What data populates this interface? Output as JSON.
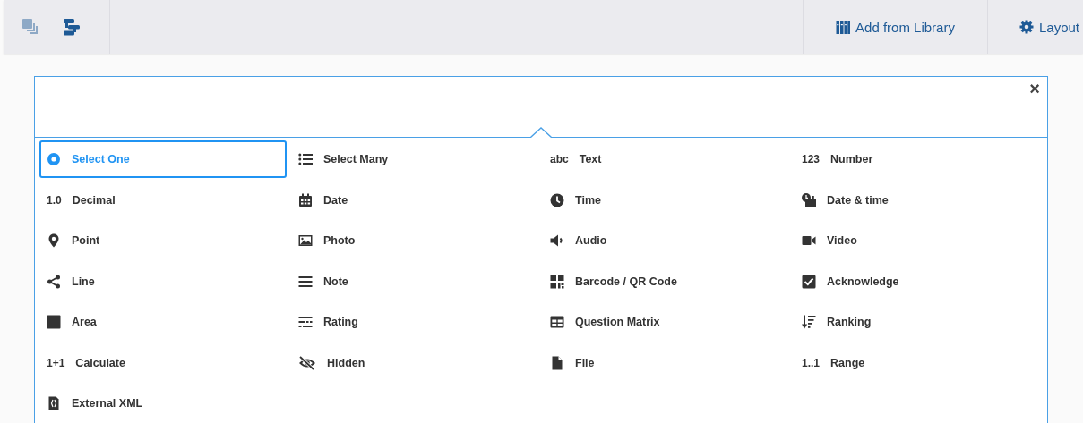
{
  "toolbar": {
    "left_icons": [
      {
        "kind": "layers",
        "disabled": true
      },
      {
        "kind": "groups",
        "disabled": false
      }
    ],
    "buttons": [
      {
        "kind": "library",
        "label": "Add from Library"
      },
      {
        "kind": "gear",
        "label": "Layout"
      }
    ]
  },
  "picker": {
    "close": "×",
    "items": [
      {
        "kind": "radio",
        "label": "Select One",
        "selected": true
      },
      {
        "kind": "list",
        "label": "Select Many",
        "selected": false
      },
      {
        "kind": "glyph",
        "glyph": "abc",
        "label": "Text",
        "selected": false
      },
      {
        "kind": "glyph",
        "glyph": "123",
        "label": "Number",
        "selected": false
      },
      {
        "kind": "glyph",
        "glyph": "1.0",
        "label": "Decimal",
        "selected": false
      },
      {
        "kind": "calendar",
        "label": "Date",
        "selected": false
      },
      {
        "kind": "clock",
        "label": "Time",
        "selected": false
      },
      {
        "kind": "datetime",
        "label": "Date & time",
        "selected": false
      },
      {
        "kind": "pin",
        "label": "Point",
        "selected": false
      },
      {
        "kind": "image",
        "label": "Photo",
        "selected": false
      },
      {
        "kind": "speaker",
        "label": "Audio",
        "selected": false
      },
      {
        "kind": "camera",
        "label": "Video",
        "selected": false
      },
      {
        "kind": "share",
        "label": "Line",
        "selected": false
      },
      {
        "kind": "lines",
        "label": "Note",
        "selected": false
      },
      {
        "kind": "qr",
        "label": "Barcode / QR Code",
        "selected": false
      },
      {
        "kind": "checkbox",
        "label": "Acknowledge",
        "selected": false
      },
      {
        "kind": "square",
        "label": "Area",
        "selected": false
      },
      {
        "kind": "dashes",
        "label": "Rating",
        "selected": false
      },
      {
        "kind": "table",
        "label": "Question Matrix",
        "selected": false
      },
      {
        "kind": "sort",
        "label": "Ranking",
        "selected": false
      },
      {
        "kind": "glyph",
        "glyph": "1+1",
        "label": "Calculate",
        "selected": false
      },
      {
        "kind": "eyeslash",
        "label": "Hidden",
        "selected": false
      },
      {
        "kind": "file",
        "label": "File",
        "selected": false
      },
      {
        "kind": "glyph",
        "glyph": "1..1",
        "label": "Range",
        "selected": false
      },
      {
        "kind": "xmlfile",
        "label": "External XML",
        "selected": false
      }
    ]
  }
}
